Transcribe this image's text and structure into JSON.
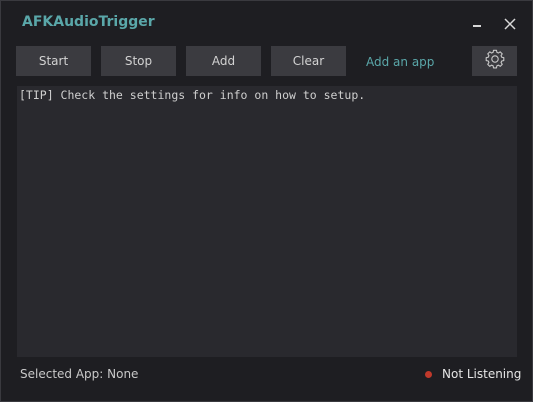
{
  "window": {
    "title": "AFKAudioTrigger"
  },
  "toolbar": {
    "start_label": "Start",
    "stop_label": "Stop",
    "add_label": "Add",
    "clear_label": "Clear",
    "add_app_link": "Add an app"
  },
  "log": {
    "lines": [
      "[TIP] Check the settings for info on how to setup."
    ]
  },
  "footer": {
    "selected_app_label": "Selected App: None",
    "status_text": "Not Listening",
    "status_color": "#c0392b"
  },
  "colors": {
    "accent": "#5aa7a9",
    "background": "#1e1e22",
    "button_bg": "#3b3b40",
    "log_bg": "#29292e"
  },
  "icons": {
    "minimize": "minimize-icon",
    "close": "close-icon",
    "settings": "gear-icon"
  }
}
